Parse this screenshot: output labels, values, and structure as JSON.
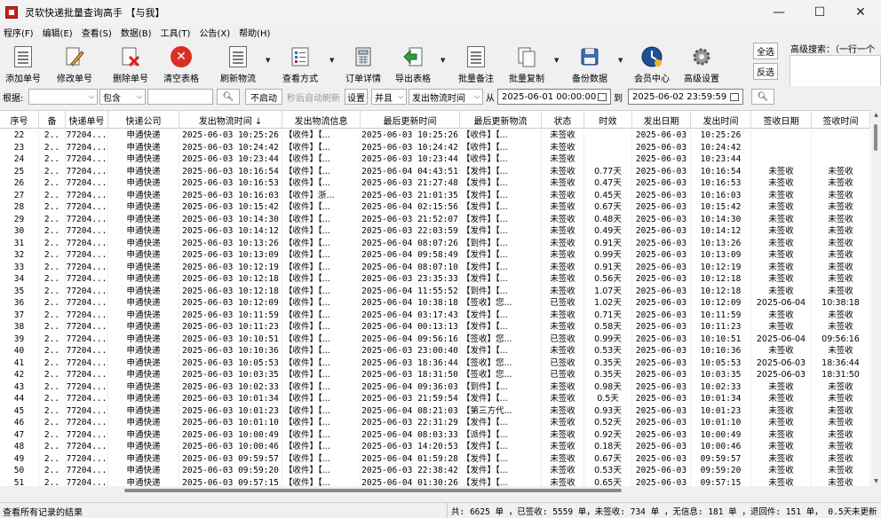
{
  "window": {
    "title": "灵软快递批量查询高手 【与我】",
    "minimize": "—",
    "maximize": "☐",
    "close": "✕"
  },
  "menu": [
    "程序(F)",
    "编辑(E)",
    "查看(S)",
    "数据(B)",
    "工具(T)",
    "公告(X)",
    "帮助(H)"
  ],
  "toolbar": {
    "buttons": [
      {
        "label": "添加单号",
        "icon": "add-doc-icon"
      },
      {
        "label": "修改单号",
        "icon": "edit-pencil-icon"
      },
      {
        "label": "删除单号",
        "icon": "delete-doc-icon"
      },
      {
        "label": "清空表格",
        "icon": "clear-red-x-icon"
      },
      {
        "label": "刷新物流",
        "icon": "refresh-doc-icon"
      },
      {
        "label": "查看方式",
        "icon": "view-list-icon"
      },
      {
        "label": "订单详情",
        "icon": "calculator-icon"
      },
      {
        "label": "导出表格",
        "icon": "export-arrow-icon"
      },
      {
        "label": "批量备注",
        "icon": "batch-note-icon"
      },
      {
        "label": "批量复制",
        "icon": "batch-copy-icon"
      },
      {
        "label": "备份数据",
        "icon": "backup-disk-icon"
      },
      {
        "label": "会员中心",
        "icon": "member-clock-icon"
      },
      {
        "label": "高级设置",
        "icon": "gear-icon"
      }
    ],
    "select_all": "全选",
    "invert": "反选",
    "adv_search_label": "高级搜索：（一行一个"
  },
  "filter": {
    "basis_label": "根据:",
    "basis_value": "",
    "op_value": "包含",
    "keyword": "",
    "search_icon": "search-icon",
    "no_auto": "不启动",
    "auto_refresh": "秒后自动刷新",
    "settings": "设置",
    "logic": "并且",
    "field": "发出物流时间",
    "from_label": "从",
    "from_value": "2025-06-01 00:00:00",
    "to_label": "到",
    "to_value": "2025-06-02 23:59:59"
  },
  "columns": [
    "序号",
    "备",
    "快递单号",
    "快递公司",
    "发出物流时间 ↓",
    "发出物流信息",
    "最后更新时间",
    "最后更新物流",
    "状态",
    "时效",
    "发出日期",
    "发出时间",
    "签收日期",
    "签收时间"
  ],
  "rows": [
    [
      "22",
      "2..",
      "77204...",
      "申通快递",
      "2025-06-03 10:25:26",
      "【收件】【...",
      "2025-06-03 10:25:26",
      "【收件】【...",
      "未签收",
      "",
      "2025-06-03",
      "10:25:26",
      "",
      ""
    ],
    [
      "23",
      "2..",
      "77204...",
      "申通快递",
      "2025-06-03 10:24:42",
      "【收件】【...",
      "2025-06-03 10:24:42",
      "【收件】【...",
      "未签收",
      "",
      "2025-06-03",
      "10:24:42",
      "",
      ""
    ],
    [
      "24",
      "2..",
      "77204...",
      "申通快递",
      "2025-06-03 10:23:44",
      "【收件】【...",
      "2025-06-03 10:23:44",
      "【收件】【...",
      "未签收",
      "",
      "2025-06-03",
      "10:23:44",
      "",
      ""
    ],
    [
      "25",
      "2..",
      "77204...",
      "申通快递",
      "2025-06-03 10:16:54",
      "【收件】【...",
      "2025-06-04 04:43:51",
      "【发件】【...",
      "未签收",
      "0.77天",
      "2025-06-03",
      "10:16:54",
      "未签收",
      "未签收"
    ],
    [
      "26",
      "2..",
      "77204...",
      "申通快递",
      "2025-06-03 10:16:53",
      "【收件】【...",
      "2025-06-03 21:27:48",
      "【发件】【...",
      "未签收",
      "0.47天",
      "2025-06-03",
      "10:16:53",
      "未签收",
      "未签收"
    ],
    [
      "27",
      "2..",
      "77204...",
      "申通快递",
      "2025-06-03 10:16:03",
      "【收件】浙...",
      "2025-06-03 21:01:35",
      "【发件】【...",
      "未签收",
      "0.45天",
      "2025-06-03",
      "10:16:03",
      "未签收",
      "未签收"
    ],
    [
      "28",
      "2..",
      "77204...",
      "申通快递",
      "2025-06-03 10:15:42",
      "【收件】【...",
      "2025-06-04 02:15:56",
      "【发件】【...",
      "未签收",
      "0.67天",
      "2025-06-03",
      "10:15:42",
      "未签收",
      "未签收"
    ],
    [
      "29",
      "2..",
      "77204...",
      "申通快递",
      "2025-06-03 10:14:30",
      "【收件】【...",
      "2025-06-03 21:52:07",
      "【发件】【...",
      "未签收",
      "0.48天",
      "2025-06-03",
      "10:14:30",
      "未签收",
      "未签收"
    ],
    [
      "30",
      "2..",
      "77204...",
      "申通快递",
      "2025-06-03 10:14:12",
      "【收件】【...",
      "2025-06-03 22:03:59",
      "【发件】【...",
      "未签收",
      "0.49天",
      "2025-06-03",
      "10:14:12",
      "未签收",
      "未签收"
    ],
    [
      "31",
      "2..",
      "77204...",
      "申通快递",
      "2025-06-03 10:13:26",
      "【收件】【...",
      "2025-06-04 08:07:26",
      "【到件】【...",
      "未签收",
      "0.91天",
      "2025-06-03",
      "10:13:26",
      "未签收",
      "未签收"
    ],
    [
      "32",
      "2..",
      "77204...",
      "申通快递",
      "2025-06-03 10:13:09",
      "【收件】【...",
      "2025-06-04 09:58:49",
      "【发件】【...",
      "未签收",
      "0.99天",
      "2025-06-03",
      "10:13:09",
      "未签收",
      "未签收"
    ],
    [
      "33",
      "2..",
      "77204...",
      "申通快递",
      "2025-06-03 10:12:19",
      "【收件】【...",
      "2025-06-04 08:07:10",
      "【发件】【...",
      "未签收",
      "0.91天",
      "2025-06-03",
      "10:12:19",
      "未签收",
      "未签收"
    ],
    [
      "34",
      "2..",
      "77204...",
      "申通快递",
      "2025-06-03 10:12:18",
      "【收件】【...",
      "2025-06-03 23:35:33",
      "【发件】【...",
      "未签收",
      "0.56天",
      "2025-06-03",
      "10:12:18",
      "未签收",
      "未签收"
    ],
    [
      "35",
      "2..",
      "77204...",
      "申通快递",
      "2025-06-03 10:12:18",
      "【收件】【...",
      "2025-06-04 11:55:52",
      "【到件】【...",
      "未签收",
      "1.07天",
      "2025-06-03",
      "10:12:18",
      "未签收",
      "未签收"
    ],
    [
      "36",
      "2..",
      "77204...",
      "申通快递",
      "2025-06-03 10:12:09",
      "【收件】【...",
      "2025-06-04 10:38:18",
      "【签收】您...",
      "已签收",
      "1.02天",
      "2025-06-03",
      "10:12:09",
      "2025-06-04",
      "10:38:18"
    ],
    [
      "37",
      "2..",
      "77204...",
      "申通快递",
      "2025-06-03 10:11:59",
      "【收件】【...",
      "2025-06-04 03:17:43",
      "【发件】【...",
      "未签收",
      "0.71天",
      "2025-06-03",
      "10:11:59",
      "未签收",
      "未签收"
    ],
    [
      "38",
      "2..",
      "77204...",
      "申通快递",
      "2025-06-03 10:11:23",
      "【收件】【...",
      "2025-06-04 00:13:13",
      "【发件】【...",
      "未签收",
      "0.58天",
      "2025-06-03",
      "10:11:23",
      "未签收",
      "未签收"
    ],
    [
      "39",
      "2..",
      "77204...",
      "申通快递",
      "2025-06-03 10:10:51",
      "【收件】【...",
      "2025-06-04 09:56:16",
      "【签收】您...",
      "已签收",
      "0.99天",
      "2025-06-03",
      "10:10:51",
      "2025-06-04",
      "09:56:16"
    ],
    [
      "40",
      "2..",
      "77204...",
      "申通快递",
      "2025-06-03 10:10:36",
      "【收件】【...",
      "2025-06-03 23:00:40",
      "【发件】【...",
      "未签收",
      "0.53天",
      "2025-06-03",
      "10:10:36",
      "未签收",
      "未签收"
    ],
    [
      "41",
      "2..",
      "77204...",
      "申通快递",
      "2025-06-03 10:05:53",
      "【收件】【...",
      "2025-06-03 18:36:44",
      "【签收】您...",
      "已签收",
      "0.35天",
      "2025-06-03",
      "10:05:53",
      "2025-06-03",
      "18:36:44"
    ],
    [
      "42",
      "2..",
      "77204...",
      "申通快递",
      "2025-06-03 10:03:35",
      "【收件】【...",
      "2025-06-03 18:31:50",
      "【签收】您...",
      "已签收",
      "0.35天",
      "2025-06-03",
      "10:03:35",
      "2025-06-03",
      "18:31:50"
    ],
    [
      "43",
      "2..",
      "77204...",
      "申通快递",
      "2025-06-03 10:02:33",
      "【收件】【...",
      "2025-06-04 09:36:03",
      "【到件】【...",
      "未签收",
      "0.98天",
      "2025-06-03",
      "10:02:33",
      "未签收",
      "未签收"
    ],
    [
      "44",
      "2..",
      "77204...",
      "申通快递",
      "2025-06-03 10:01:34",
      "【收件】【...",
      "2025-06-03 21:59:54",
      "【发件】【...",
      "未签收",
      "0.5天",
      "2025-06-03",
      "10:01:34",
      "未签收",
      "未签收"
    ],
    [
      "45",
      "2..",
      "77204...",
      "申通快递",
      "2025-06-03 10:01:23",
      "【收件】【...",
      "2025-06-04 08:21:03",
      "【第三方代...",
      "未签收",
      "0.93天",
      "2025-06-03",
      "10:01:23",
      "未签收",
      "未签收"
    ],
    [
      "46",
      "2..",
      "77204...",
      "申通快递",
      "2025-06-03 10:01:10",
      "【收件】【...",
      "2025-06-03 22:31:29",
      "【发件】【...",
      "未签收",
      "0.52天",
      "2025-06-03",
      "10:01:10",
      "未签收",
      "未签收"
    ],
    [
      "47",
      "2..",
      "77204...",
      "申通快递",
      "2025-06-03 10:00:49",
      "【收件】【...",
      "2025-06-04 08:03:33",
      "【派件】【...",
      "未签收",
      "0.92天",
      "2025-06-03",
      "10:00:49",
      "未签收",
      "未签收"
    ],
    [
      "48",
      "2..",
      "77204...",
      "申通快递",
      "2025-06-03 10:00:46",
      "【收件】【...",
      "2025-06-03 14:20:53",
      "【发件】【...",
      "未签收",
      "0.18天",
      "2025-06-03",
      "10:00:46",
      "未签收",
      "未签收"
    ],
    [
      "49",
      "2..",
      "77204...",
      "申通快递",
      "2025-06-03 09:59:57",
      "【收件】【...",
      "2025-06-04 01:59:28",
      "【发件】【...",
      "未签收",
      "0.67天",
      "2025-06-03",
      "09:59:57",
      "未签收",
      "未签收"
    ],
    [
      "50",
      "2..",
      "77204...",
      "申通快递",
      "2025-06-03 09:59:20",
      "【收件】【...",
      "2025-06-03 22:38:42",
      "【发件】【...",
      "未签收",
      "0.53天",
      "2025-06-03",
      "09:59:20",
      "未签收",
      "未签收"
    ],
    [
      "51",
      "2..",
      "77204...",
      "申通快递",
      "2025-06-03 09:57:15",
      "【收件】【...",
      "2025-06-04 01:30:26",
      "【发件】【...",
      "未签收",
      "0.65天",
      "2025-06-03",
      "09:57:15",
      "未签收",
      "未签收"
    ]
  ],
  "status": {
    "left": "查看所有记录的结果",
    "right": "共: 6625 单 ，已签收:  5559 单，未签收:  734 单 ，无信息: 181 单 ，退回件: 151 单， 0.5天未更新"
  }
}
